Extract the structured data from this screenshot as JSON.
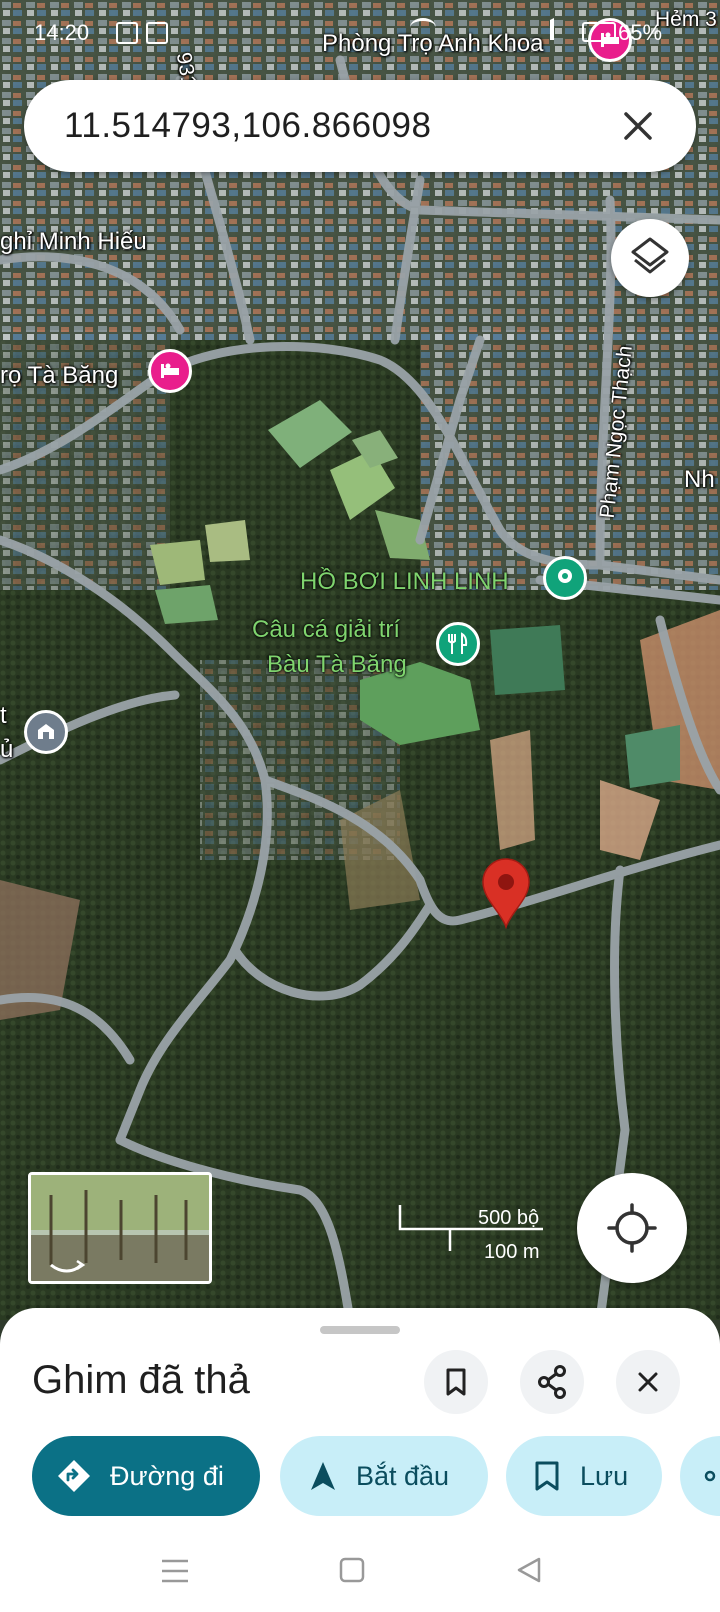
{
  "status_bar": {
    "time": "14:20",
    "battery": "65%"
  },
  "search": {
    "coords": "11.514793,106.866098"
  },
  "map_labels": {
    "phong_tro_anh_khoa": "Phòng Trọ Anh Khoa",
    "hem": "Hẻm 3",
    "road_931": "931",
    "nghi_minh_hieu": "ghỉ Minh Hiếu",
    "tro_ta_bang": "rọ Tà Băng",
    "pham_ngoc_thach": "Phạm Ngọc Thạch",
    "nh": "Nh",
    "ho_boi": "HỒ BƠI LINH LINH",
    "cau_ca_line1": "Câu cá giải trí",
    "cau_ca_line2": "Bàu Tà Băng",
    "left_t": "t",
    "left_u": "ủ"
  },
  "scale": {
    "imperial": "500 bộ",
    "metric": "100 m"
  },
  "sheet": {
    "title": "Ghim đã thả",
    "chips": {
      "directions": "Đường đi",
      "start": "Bắt đầu",
      "save": "Lưu"
    }
  },
  "colors": {
    "teal": "#0b7186",
    "chip_light": "#c8eef8",
    "pin_red": "#d93025",
    "poi_pink": "#e91e8c",
    "poi_green": "#10a37a"
  }
}
